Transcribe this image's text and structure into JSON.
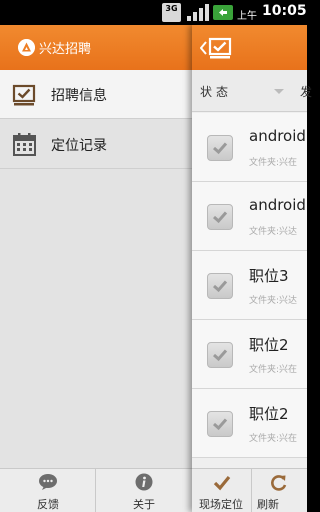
{
  "status_bar": {
    "network_badge": "3G",
    "ampm": "上午",
    "time": "10:05"
  },
  "drawer": {
    "app_title": "兴达招聘",
    "menu": [
      {
        "label": "招聘信息",
        "icon": "checkbox-icon",
        "selected": true
      },
      {
        "label": "定位记录",
        "icon": "calendar-icon",
        "selected": false
      }
    ],
    "bottom": {
      "feedback_label": "反馈",
      "about_label": "关于"
    }
  },
  "content": {
    "filter": {
      "status_label": "状态",
      "second_label_partial": "发"
    },
    "list": [
      {
        "title": "android",
        "subtitle": "文件夹:兴在",
        "checked": true
      },
      {
        "title": "android",
        "subtitle": "文件夹:兴达",
        "checked": true
      },
      {
        "title": "职位3",
        "subtitle": "文件夹:兴达",
        "checked": true
      },
      {
        "title": "职位2",
        "subtitle": "文件夹:兴在",
        "checked": true
      },
      {
        "title": "职位2",
        "subtitle": "文件夹:兴在",
        "checked": true
      }
    ],
    "bottom": {
      "locate_label": "现场定位",
      "refresh_label": "刷新"
    }
  },
  "colors": {
    "accent": "#ee7f26",
    "drawer_bg": "#e3e3e3",
    "list_bg": "#f7f7f7"
  }
}
